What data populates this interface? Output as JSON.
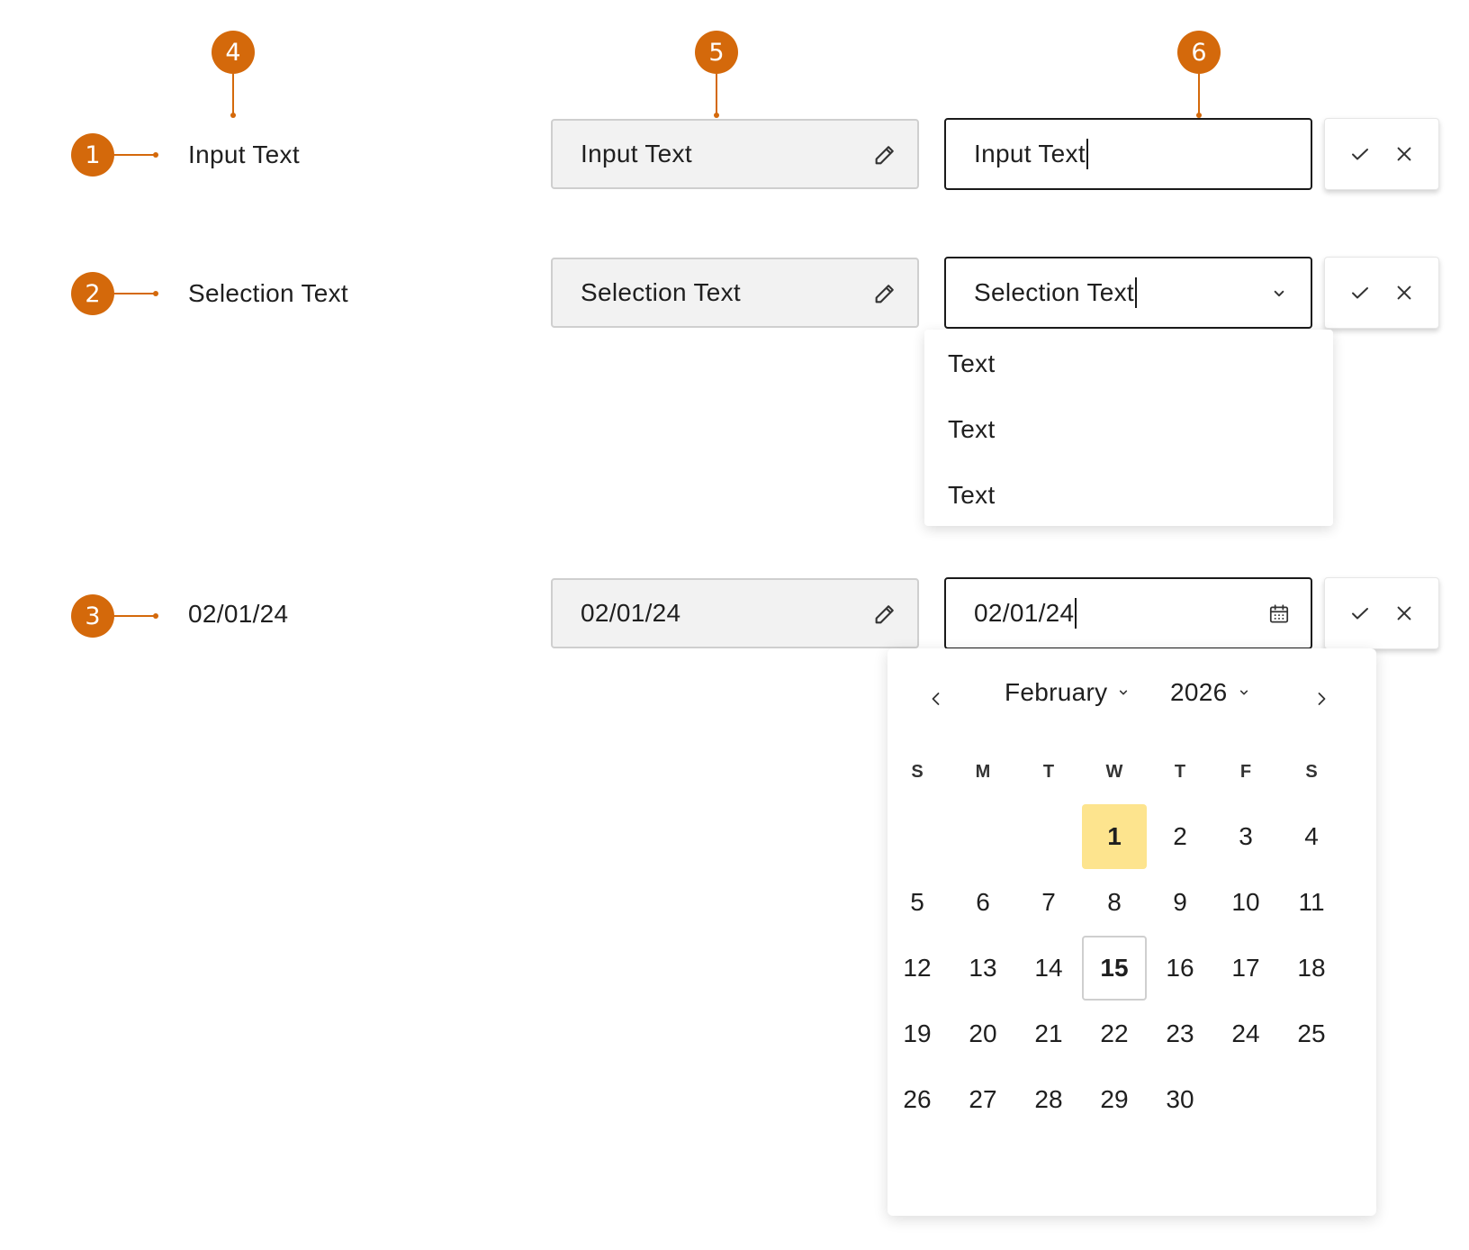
{
  "colors": {
    "accent": "#d4690b",
    "selected_day_bg": "#fde48e",
    "readonly_bg": "#f2f2f2",
    "border_dark": "#1a1a1a"
  },
  "annotations": {
    "rows": [
      "1",
      "2",
      "3"
    ],
    "columns": [
      "4",
      "5",
      "6"
    ]
  },
  "rows": [
    {
      "label": "Input Text",
      "readonly_value": "Input Text",
      "edit_value": "Input Text",
      "trailing_icon": "none"
    },
    {
      "label": "Selection Text",
      "readonly_value": "Selection Text",
      "edit_value": "Selection Text",
      "trailing_icon": "chevron-down-icon"
    },
    {
      "label": "02/01/24",
      "readonly_value": "02/01/24",
      "edit_value": "02/01/24",
      "trailing_icon": "calendar-icon"
    }
  ],
  "icons": {
    "edit": "pencil-icon",
    "confirm": "check-icon",
    "cancel": "close-icon"
  },
  "dropdown": {
    "options": [
      "Text",
      "Text",
      "Text"
    ]
  },
  "calendar": {
    "month": "February",
    "year": "2026",
    "weekdays": [
      "S",
      "M",
      "T",
      "W",
      "T",
      "F",
      "S"
    ],
    "first_weekday_index": 3,
    "days_in_month": 30,
    "selected_day": 1,
    "today_day": 15
  }
}
